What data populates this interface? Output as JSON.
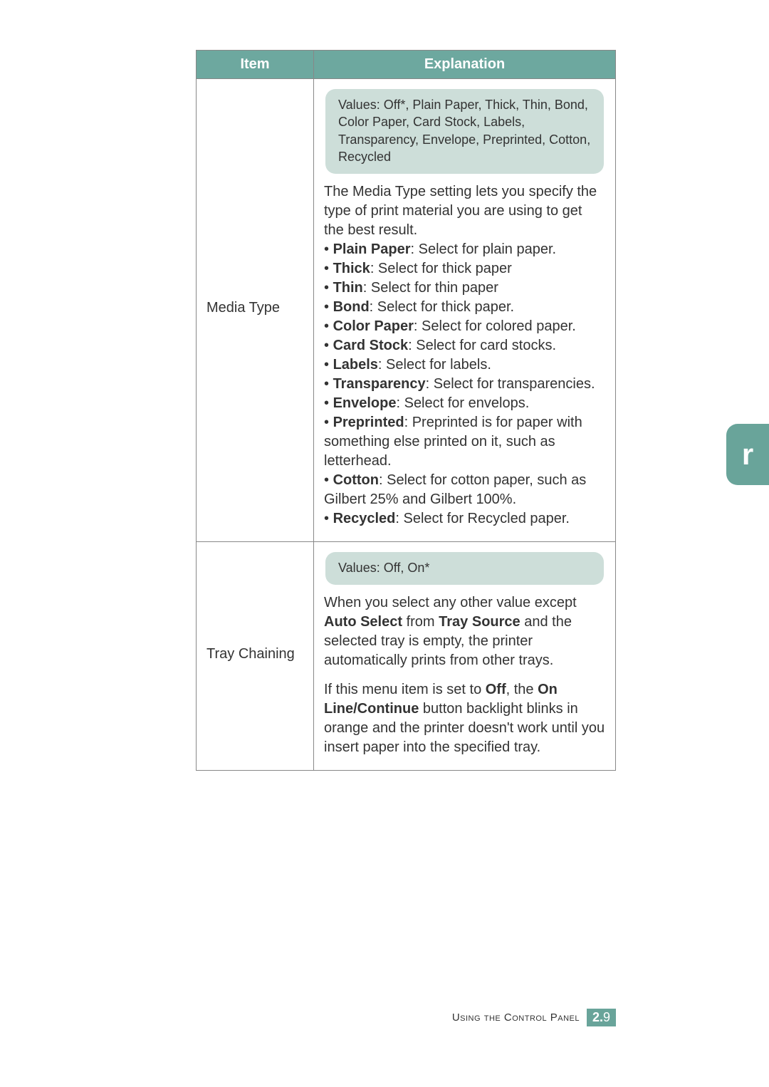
{
  "headers": {
    "item": "Item",
    "explanation": "Explanation"
  },
  "rows": {
    "media_type": {
      "item": "Media Type",
      "values": "Values: Off*, Plain Paper, Thick, Thin, Bond, Color Paper, Card Stock, Labels, Transparency, Envelope, Preprinted, Cotton, Recycled",
      "intro": "The Media Type setting lets you specify the type of print material you are using to get the best result.",
      "bullets": {
        "plain_label": "Plain Paper",
        "plain_text": ": Select for plain paper.",
        "thick_label": "Thick",
        "thick_text": ": Select for thick paper",
        "thin_label": "Thin",
        "thin_text": ": Select for thin paper",
        "bond_label": "Bond",
        "bond_text": ": Select for thick paper.",
        "color_label": "Color Paper",
        "color_text": ": Select for colored paper.",
        "card_label": "Card Stock",
        "card_text": ": Select for card stocks.",
        "labels_label": "Labels",
        "labels_text": ": Select for labels.",
        "trans_label": "Transparency",
        "trans_text": ": Select for transparencies.",
        "env_label": "Envelope",
        "env_text": ": Select for envelops.",
        "pre_label": "Preprinted",
        "pre_text": ": Preprinted is for paper with something else printed on it, such as letterhead.",
        "cotton_label": "Cotton",
        "cotton_text": ": Select for cotton paper, such as Gilbert 25% and Gilbert 100%.",
        "rec_label": "Recycled",
        "rec_text": ": Select for Recycled paper."
      }
    },
    "tray_chaining": {
      "item": "Tray Chaining",
      "values": "Values: Off, On*",
      "p1_a": "When you select any other value except ",
      "p1_b_auto": "Auto Select",
      "p1_c": " from ",
      "p1_d_tray": "Tray Source",
      "p1_e": " and the selected tray is empty, the printer automatically prints from other trays.",
      "p2_a": "If this menu item is set to ",
      "p2_b_off": "Off",
      "p2_c": ", the ",
      "p2_d_online": "On Line/Continue",
      "p2_e": " button backlight blinks in orange and the printer doesn't work until you insert paper into the specified tray."
    }
  },
  "tab": "r",
  "footer": {
    "label": "Using the Control Panel",
    "chapter": "2.",
    "page": "9"
  }
}
